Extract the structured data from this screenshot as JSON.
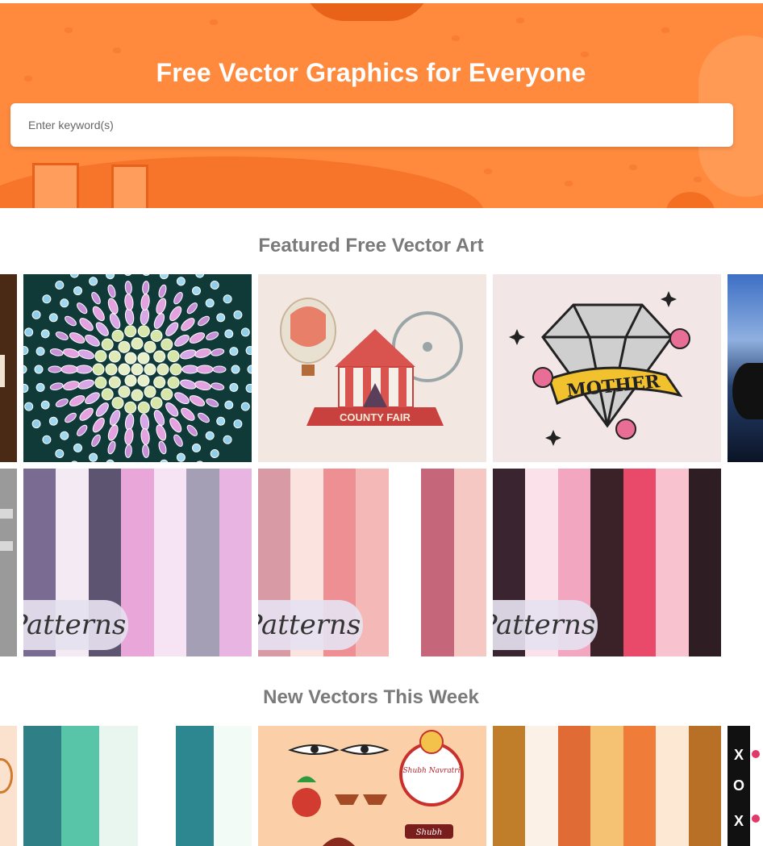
{
  "hero": {
    "title": "Free Vector Graphics for Everyone",
    "search_placeholder": "Enter keyword(s)",
    "background_color": "#ff8a3d"
  },
  "featured": {
    "title": "Featured Free Vector Art",
    "row1": [
      {
        "name": "partial-brown-card"
      },
      {
        "name": "crystal-mandala"
      },
      {
        "name": "county-fair",
        "label": "COUNTY FAIR"
      },
      {
        "name": "mother-diamond-tattoo",
        "label": "MOTHER"
      },
      {
        "name": "partial-night-landscape"
      }
    ],
    "row2": [
      {
        "name": "partial-grey-card"
      },
      {
        "name": "purple-floral-patterns",
        "badge": "Patterns"
      },
      {
        "name": "pink-rose-patterns",
        "badge": "Patterns"
      },
      {
        "name": "red-floral-patterns",
        "badge": "Patterns"
      },
      {
        "name": "partial-white-card"
      }
    ]
  },
  "new_vectors": {
    "title": "New Vectors This Week",
    "row": [
      {
        "name": "partial-peach-card"
      },
      {
        "name": "teal-leaf-patterns"
      },
      {
        "name": "navratri-elements",
        "labels": [
          "Shubh Navratri",
          "Shubh"
        ]
      },
      {
        "name": "autumn-floral-patterns"
      },
      {
        "name": "partial-xo-pattern",
        "marks": [
          "X",
          "O",
          "X"
        ]
      }
    ]
  }
}
